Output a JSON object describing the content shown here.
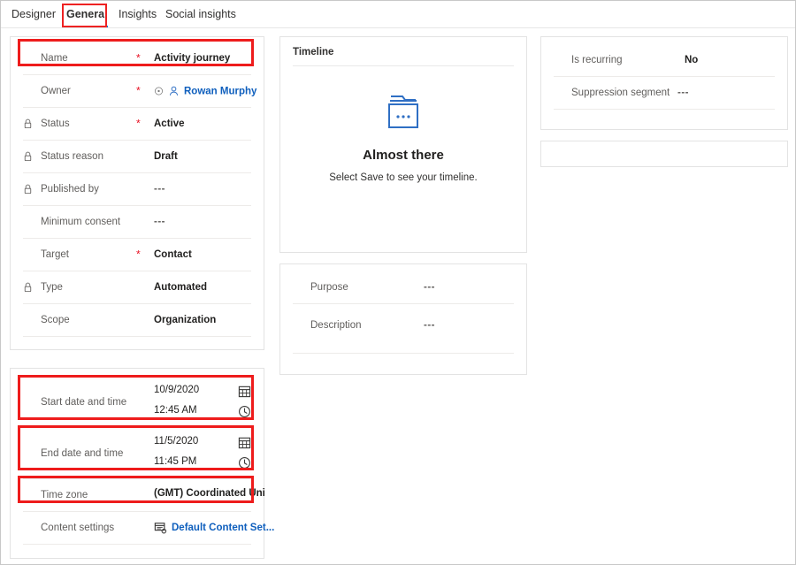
{
  "tabs": [
    {
      "label": "Designer",
      "active": false
    },
    {
      "label": "General",
      "active": true
    },
    {
      "label": "Insights",
      "active": false
    },
    {
      "label": "Social insights",
      "active": false
    }
  ],
  "colors": {
    "accent": "#0078d4",
    "link": "#0f5fbd",
    "required": "#e81123",
    "annotation": "#ee1c1c",
    "panel_border": "#e3e3e3",
    "row_rule": "#edebe9",
    "label": "#605e5c",
    "value": "#201f1e"
  },
  "summary_panel": {
    "fields": [
      {
        "label": "Name",
        "required": true,
        "locked": false,
        "value": "Activity journey",
        "kind": "text"
      },
      {
        "label": "Owner",
        "required": true,
        "locked": false,
        "value": "Rowan Murphy",
        "kind": "owner"
      },
      {
        "label": "Status",
        "required": true,
        "locked": true,
        "value": "Active",
        "kind": "text"
      },
      {
        "label": "Status reason",
        "required": false,
        "locked": true,
        "value": "Draft",
        "kind": "text"
      },
      {
        "label": "Published by",
        "required": false,
        "locked": true,
        "value": "---",
        "kind": "empty"
      },
      {
        "label": "Minimum consent",
        "required": false,
        "locked": false,
        "value": "---",
        "kind": "empty"
      },
      {
        "label": "Target",
        "required": true,
        "locked": false,
        "value": "Contact",
        "kind": "text"
      },
      {
        "label": "Type",
        "required": false,
        "locked": true,
        "value": "Automated",
        "kind": "text"
      },
      {
        "label": "Scope",
        "required": false,
        "locked": false,
        "value": "Organization",
        "kind": "text"
      }
    ]
  },
  "schedule_panel": {
    "start": {
      "label": "Start date and time",
      "date": "10/9/2020",
      "time": "12:45 AM"
    },
    "end": {
      "label": "End date and time",
      "date": "11/5/2020",
      "time": "11:45 PM"
    },
    "time_zone": {
      "label": "Time zone",
      "value": "(GMT) Coordinated Universal Time"
    },
    "content_settings": {
      "label": "Content settings",
      "value": "Default Content Set..."
    }
  },
  "timeline_panel": {
    "title": "Timeline",
    "empty_state": {
      "heading": "Almost there",
      "message": "Select Save to see your timeline."
    }
  },
  "purpose_panel": {
    "fields": [
      {
        "label": "Purpose",
        "value": "---"
      },
      {
        "label": "Description",
        "value": "---"
      }
    ]
  },
  "recurrence_panel": {
    "fields": [
      {
        "label": "Is recurring",
        "value": "No"
      },
      {
        "label": "Suppression segment",
        "value": "---"
      }
    ]
  },
  "icons": {
    "lock": "lock-icon",
    "calendar": "calendar-icon",
    "clock": "clock-icon",
    "person": "person-icon",
    "presence": "presence-icon",
    "content_settings": "content-settings-icon",
    "folder": "folder-icon"
  }
}
